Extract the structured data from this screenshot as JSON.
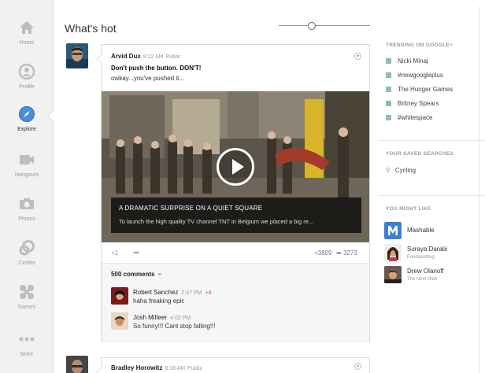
{
  "nav": {
    "items": [
      {
        "label": "Home",
        "icon": "home-icon"
      },
      {
        "label": "Profile",
        "icon": "profile-icon"
      },
      {
        "label": "Explore",
        "icon": "compass-icon"
      },
      {
        "label": "Hangouts",
        "icon": "video-camera-icon"
      },
      {
        "label": "Photos",
        "icon": "camera-icon"
      },
      {
        "label": "Circles",
        "icon": "circles-icon"
      },
      {
        "label": "Games",
        "icon": "games-icon"
      },
      {
        "label": "More",
        "icon": "more-dots-icon"
      }
    ],
    "active": "Explore"
  },
  "stream": {
    "title": "What's hot",
    "slider_level": 0.35
  },
  "post": {
    "author": "Arvid Dux",
    "time": "9:22 AM",
    "visibility": "Public",
    "headline": "Don't push the button. DON'T!",
    "body": "owkay...you've pushed it...",
    "video": {
      "title": "A DRAMATIC SURPRISE ON A QUIET SQUARE",
      "description": "To launch the high quality TV channel TNT in Belgium we placed a big re..."
    },
    "plus_one": "+1",
    "plus_count": "+3809",
    "share_count": "3273",
    "comment_count": "500 comments",
    "comments": [
      {
        "name": "Robert Sanchez",
        "time": "2:47 PM",
        "plus": "+4",
        "text": "haha freaking epic"
      },
      {
        "name": "Josh Milteer",
        "time": "4:02 PM",
        "text": "So funny!!! Cant stop falling!!!"
      }
    ]
  },
  "next_post": {
    "author": "Bradley Horowitz",
    "time": "8:18 AM",
    "visibility": "Public"
  },
  "sidebar": {
    "trending_title": "TRENDING ON GOOGLE+",
    "trending": [
      "Nicki Minaj",
      "#newgoogleplus",
      "The Hunger Games",
      "Britney Spears",
      "#whitespace"
    ],
    "saved_title": "YOUR SAVED SEARCHES",
    "saved": [
      "Cycling"
    ],
    "like_title": "YOU MIGHT LIKE",
    "likes": [
      {
        "name": "Mashable",
        "sub": ""
      },
      {
        "name": "Soraya Darabi",
        "sub": "Foodspotting"
      },
      {
        "name": "Drew Olanoff",
        "sub": "The Next Web"
      }
    ]
  },
  "colors": {
    "accent_red": "#e8212b",
    "trend_dot": "#8fc09f",
    "mashable_blue": "#3e7ed6"
  }
}
